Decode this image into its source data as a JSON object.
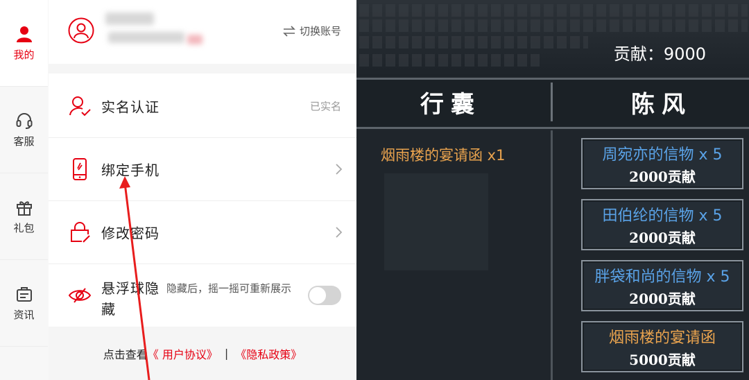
{
  "sdk": {
    "nav": [
      {
        "label": "我的",
        "icon": "user-icon",
        "active": true
      },
      {
        "label": "客服",
        "icon": "headset-icon",
        "active": false
      },
      {
        "label": "礼包",
        "icon": "gift-icon",
        "active": false
      },
      {
        "label": "资讯",
        "icon": "news-icon",
        "active": false
      }
    ],
    "account": {
      "switch_label": "切换账号",
      "avatar_icon": "avatar-icon",
      "switch_icon": "swap-arrows-icon"
    },
    "rows": {
      "realname": {
        "title": "实名认证",
        "status": "已实名",
        "icon": "verify-person-icon"
      },
      "bind_phone": {
        "title": "绑定手机",
        "icon": "phone-icon"
      },
      "change_password": {
        "title": "修改密码",
        "icon": "lock-edit-icon"
      },
      "float_ball": {
        "title": "悬浮球隐藏",
        "desc": "隐藏后，摇一摇可重新展示",
        "icon": "eye-hide-icon",
        "enabled": false
      }
    },
    "footer": {
      "prefix": "点击查看",
      "user_agreement": "《 用户协议》",
      "separator": "|",
      "privacy_policy": "《隐私政策》"
    },
    "accent_color": "#e60012"
  },
  "game": {
    "contribution": "贡献：9000",
    "columns": {
      "bag": "行囊",
      "merchant": "陈风"
    },
    "bag_item": "烟雨楼的宴请函 x1",
    "shop_items": [
      {
        "name": "周宛亦的信物 x 5",
        "price": "2000贡献",
        "color": "#5aa3e8"
      },
      {
        "name": "田伯纶的信物 x 5",
        "price": "2000贡献",
        "color": "#5aa3e8"
      },
      {
        "name": "胖袋和尚的信物 x 5",
        "price": "2000贡献",
        "color": "#5aa3e8"
      },
      {
        "name": "烟雨楼的宴请函",
        "price": "5000贡献",
        "color": "#e9a34e"
      }
    ]
  }
}
